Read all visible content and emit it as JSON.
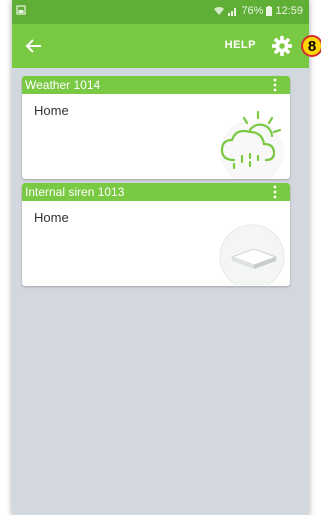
{
  "status_bar": {
    "signal": "📶",
    "battery_percent": "76%",
    "time": "12:59"
  },
  "toolbar": {
    "help_label": "HELP"
  },
  "annotation_badge": "8",
  "devices": [
    {
      "name": "Weather 1014",
      "location": "Home",
      "icon": "weather-rain-sun-icon"
    },
    {
      "name": "Internal siren 1013",
      "location": "Home",
      "icon": "siren-device-icon"
    }
  ],
  "colors": {
    "accent": "#7ac943",
    "status_bar": "#5fae36",
    "background": "#d3d8df"
  }
}
